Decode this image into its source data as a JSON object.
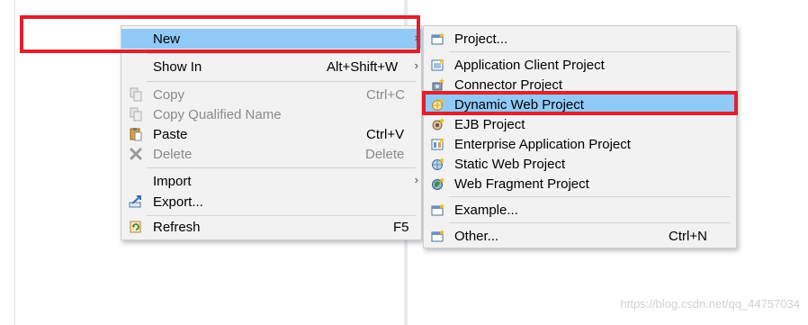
{
  "context_menu": {
    "items": {
      "new": {
        "label": "New"
      },
      "show_in": {
        "label": "Show In",
        "shortcut": "Alt+Shift+W"
      },
      "copy": {
        "label": "Copy",
        "shortcut": "Ctrl+C"
      },
      "copy_qualified": {
        "label": "Copy Qualified Name"
      },
      "paste": {
        "label": "Paste",
        "shortcut": "Ctrl+V"
      },
      "delete": {
        "label": "Delete",
        "shortcut": "Delete"
      },
      "import": {
        "label": "Import"
      },
      "export": {
        "label": "Export..."
      },
      "refresh": {
        "label": "Refresh",
        "shortcut": "F5"
      }
    }
  },
  "submenu": {
    "items": {
      "project": {
        "label": "Project..."
      },
      "app_client": {
        "label": "Application Client Project"
      },
      "connector": {
        "label": "Connector Project"
      },
      "dynamic_web": {
        "label": "Dynamic Web Project"
      },
      "ejb": {
        "label": "EJB Project"
      },
      "enterprise_app": {
        "label": "Enterprise Application Project"
      },
      "static_web": {
        "label": "Static Web Project"
      },
      "web_fragment": {
        "label": "Web Fragment Project"
      },
      "example": {
        "label": "Example..."
      },
      "other": {
        "label": "Other...",
        "shortcut": "Ctrl+N"
      }
    }
  },
  "watermark": "https://blog.csdn.net/qq_44757034",
  "colors": {
    "selection": "#91c9f7",
    "highlight_box": "#e0212c",
    "menu_bg": "#f2f2f2"
  }
}
